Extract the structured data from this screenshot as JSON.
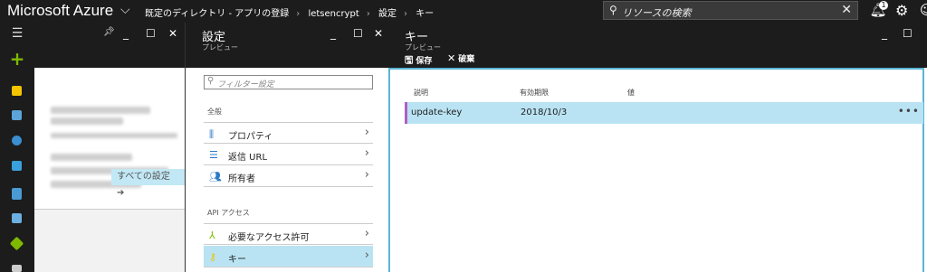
{
  "topbar": {
    "brand": "Microsoft Azure",
    "breadcrumbs": [
      "既定のディレクトリ - アプリの登録",
      "letsencrypt",
      "設定",
      "キー"
    ],
    "search_placeholder": "リソースの検索",
    "notification_count": "1"
  },
  "blade1": {
    "all_settings_label": "すべての設定 ➔"
  },
  "settings": {
    "title": "設定",
    "subtitle": "プレビュー",
    "filter_placeholder": "フィルター設定",
    "section_general": "全般",
    "section_api": "API アクセス",
    "items": [
      {
        "label": "プロパティ"
      },
      {
        "label": "返信 URL"
      },
      {
        "label": "所有者"
      },
      {
        "label": "必要なアクセス許可"
      },
      {
        "label": "キー"
      }
    ]
  },
  "keys": {
    "title": "キー",
    "subtitle": "プレビュー",
    "save_label": "保存",
    "discard_label": "破棄",
    "columns": [
      "説明",
      "有効期限",
      "値"
    ],
    "rows": [
      {
        "description": "update-key",
        "expires": "2018/10/3",
        "value": ""
      }
    ]
  },
  "colors": {
    "accent": "#5bb5d6",
    "selection": "#b9e3f3",
    "row_marker": "#b05fc1",
    "dark": "#1c1c1c",
    "plus": "#7fba00"
  }
}
